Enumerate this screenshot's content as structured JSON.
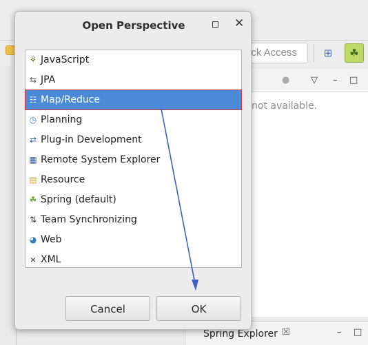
{
  "background": {
    "quick_access_placeholder": "ick Access",
    "view_message": "not available.",
    "bottom_tab_label": "Spring Explorer"
  },
  "dialog": {
    "title": "Open Perspective",
    "items": [
      {
        "label": "JavaScript",
        "icon": "javascript-icon"
      },
      {
        "label": "JPA",
        "icon": "jpa-icon"
      },
      {
        "label": "Map/Reduce",
        "icon": "mapreduce-icon",
        "selected": true
      },
      {
        "label": "Planning",
        "icon": "planning-icon"
      },
      {
        "label": "Plug-in Development",
        "icon": "plugin-icon"
      },
      {
        "label": "Remote System Explorer",
        "icon": "remote-system-icon"
      },
      {
        "label": "Resource",
        "icon": "folder-icon"
      },
      {
        "label": "Spring (default)",
        "icon": "spring-leaf-icon"
      },
      {
        "label": "Team Synchronizing",
        "icon": "sync-icon"
      },
      {
        "label": "Web",
        "icon": "web-globe-icon"
      },
      {
        "label": "XML",
        "icon": "xml-icon"
      }
    ],
    "cancel_label": "Cancel",
    "ok_label": "OK"
  },
  "colors": {
    "selection": "#4a8ad6",
    "highlight_box": "#d9302c",
    "arrow": "#3e5fc4"
  }
}
